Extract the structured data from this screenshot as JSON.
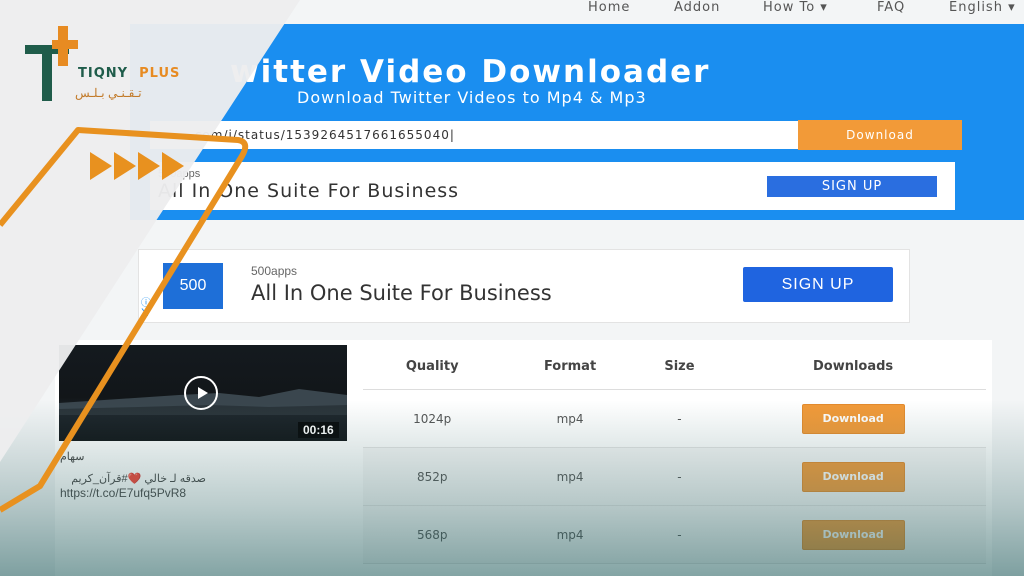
{
  "nav": {
    "items": [
      "Home",
      "Addon",
      "How To ▾",
      "FAQ",
      "English ▾"
    ]
  },
  "hero": {
    "title": "witter Video Downloader",
    "subtitle": "Download Twitter Videos to Mp4 & Mp3",
    "url_value": ".com/i/status/1539264517661655040|",
    "download_label": "Download"
  },
  "ad_top": {
    "brand": "500apps",
    "text": "All In One Suite For Business",
    "button": "SIGN UP",
    "close": "X"
  },
  "ad_main": {
    "logo": "500",
    "brand": "500apps",
    "text": "All In One Suite For Business",
    "button": "SIGN UP",
    "close": "X"
  },
  "video": {
    "duration": "00:16",
    "author": "سهام",
    "caption": "صدقه لـ خالي ❤️#قرآن_كريم",
    "link": "https://t.co/E7ufq5PvR8"
  },
  "table": {
    "headers": [
      "Quality",
      "Format",
      "Size",
      "Downloads"
    ],
    "rows": [
      {
        "quality": "1024p",
        "format": "mp4",
        "size": "-",
        "button": "Download"
      },
      {
        "quality": "852p",
        "format": "mp4",
        "size": "-",
        "button": "Download"
      },
      {
        "quality": "568p",
        "format": "mp4",
        "size": "-",
        "button": "Download"
      }
    ]
  },
  "brand": {
    "name_primary": "TIQNY",
    "name_secondary": "PLUS",
    "name_arabic": "تـقـنـي بـلـس",
    "colors": {
      "green": "#1f5c4a",
      "orange": "#e78b22",
      "blue": "#1a8ef0"
    }
  }
}
